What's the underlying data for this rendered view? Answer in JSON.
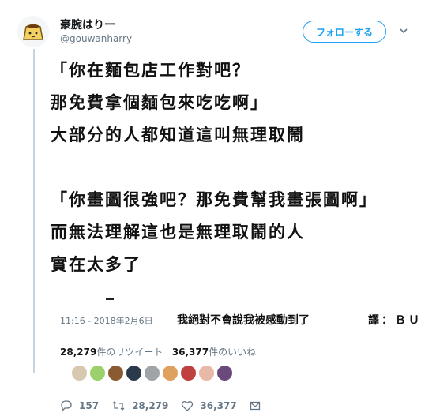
{
  "author": {
    "display_name": "豪腕はりー",
    "handle": "@gouwanharry",
    "follow_label": "フォローする",
    "avatar_icon": "pudding-avatar-icon",
    "menu_icon": "chevron-down-icon"
  },
  "tweet_lines": [
    "「你在麵包店工作對吧？",
    "那免費拿個麵包來吃吃啊」",
    "大部分的人都知道這叫無理取鬧",
    "",
    "「你畫圖很強吧？那免費幫我畫張圖啊」",
    "而無法理解這也是無理取鬧的人",
    "實在太多了"
  ],
  "timestamp": "11:16 - 2018年2月6日",
  "overlay_caption": "我絕對不會說我被感動到了",
  "translator_credit": "譯：ＢＵ",
  "stats": {
    "retweets": "28,279",
    "retweets_label": "件のリツイート",
    "likes": "36,377",
    "likes_label": "件のいいね"
  },
  "actions": {
    "reply_count": "157",
    "retweet_count": "28,279",
    "like_count": "36,377"
  },
  "colors": {
    "accent": "#1da1f2",
    "muted": "#657786",
    "thread_line": "#c7d4de"
  }
}
